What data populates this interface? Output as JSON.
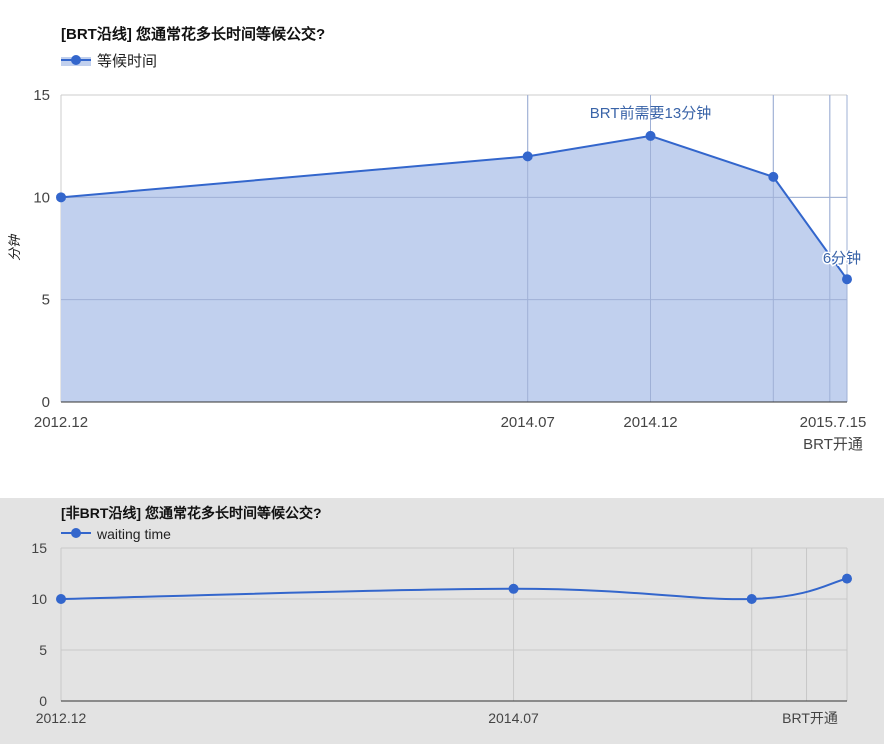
{
  "chart_data": [
    {
      "type": "area",
      "title": "[BRT沿线] 您通常花多长时间等候公交?",
      "ylabel": "分钟",
      "ylim": [
        0,
        15
      ],
      "y_ticks": [
        0,
        5,
        10,
        15
      ],
      "grid": true,
      "legend_position": "top-left",
      "x_tick_labels": [
        {
          "label": "2012.12",
          "x": 0
        },
        {
          "label": "2014.07",
          "x": 19
        },
        {
          "label": "2014.12",
          "x": 24
        },
        {
          "label": "2015.7.15",
          "x": 31.3
        },
        {
          "label": "BRT开通",
          "x": 31.3
        }
      ],
      "series": [
        {
          "name": "等候时间",
          "color": "#3366cc",
          "fill_color": "#c1d0ee",
          "points": [
            {
              "x": 0,
              "y": 10
            },
            {
              "x": 19,
              "y": 12
            },
            {
              "x": 24,
              "y": 13
            },
            {
              "x": 29,
              "y": 11
            },
            {
              "x": 32,
              "y": 6
            }
          ]
        }
      ],
      "annotations": [
        {
          "point_index": 2,
          "text": "BRT前需要13分钟"
        },
        {
          "point_index": 4,
          "text": "6分钟"
        }
      ],
      "x_range": [
        0,
        32
      ],
      "vertical_gridlines_x": [
        19,
        24,
        29,
        31.3,
        32
      ]
    },
    {
      "type": "line",
      "title": "[非BRT沿线] 您通常花多长时间等候公交?",
      "ylabel": "",
      "ylim": [
        0,
        15
      ],
      "y_ticks": [
        0,
        5,
        10,
        15
      ],
      "grid": true,
      "legend_position": "top-left",
      "x_tick_labels": [
        {
          "label": "2012.12",
          "x": 0
        },
        {
          "label": "2014.07",
          "x": 19
        },
        {
          "label": "BRT开通",
          "x": 31.3
        }
      ],
      "series": [
        {
          "name": "waiting time",
          "color": "#3366cc",
          "points": [
            {
              "x": 0,
              "y": 10
            },
            {
              "x": 19,
              "y": 11
            },
            {
              "x": 29,
              "y": 10
            },
            {
              "x": 33,
              "y": 12
            }
          ]
        }
      ],
      "annotations": [],
      "x_range": [
        0,
        33
      ],
      "vertical_gridlines_x": [
        19,
        29,
        31.3,
        33
      ]
    }
  ],
  "colors": {
    "series": "#3366cc",
    "area_fill": "#c1d0ee",
    "grid": "#cccccc",
    "baseline": "#333333",
    "bottom_background": "#e3e3e3"
  }
}
